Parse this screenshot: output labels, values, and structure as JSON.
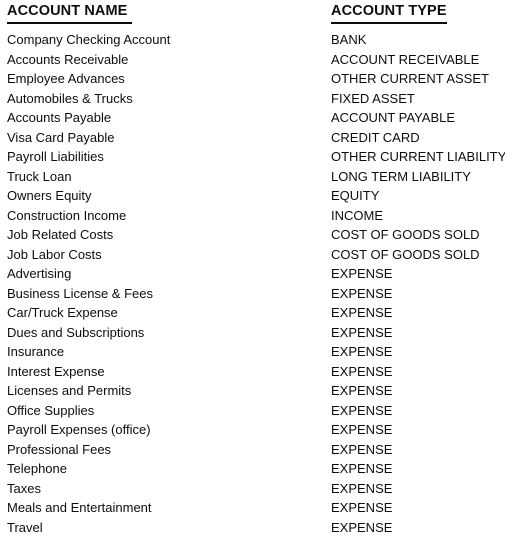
{
  "table": {
    "columns": [
      {
        "key": "name",
        "label": "ACCOUNT NAME "
      },
      {
        "key": "type",
        "label": "ACCOUNT TYPE"
      }
    ],
    "rows": [
      {
        "name": "Company Checking Account",
        "type": "BANK"
      },
      {
        "name": "Accounts Receivable",
        "type": "ACCOUNT RECEIVABLE"
      },
      {
        "name": "Employee Advances",
        "type": "OTHER CURRENT ASSET"
      },
      {
        "name": "Automobiles & Trucks",
        "type": "FIXED ASSET"
      },
      {
        "name": "Accounts Payable",
        "type": "ACCOUNT PAYABLE"
      },
      {
        "name": "Visa Card Payable",
        "type": "CREDIT CARD"
      },
      {
        "name": "Payroll Liabilities",
        "type": "OTHER CURRENT LIABILITY"
      },
      {
        "name": "Truck Loan",
        "type": "LONG TERM LIABILITY"
      },
      {
        "name": "Owners Equity",
        "type": "EQUITY"
      },
      {
        "name": "Construction Income",
        "type": "INCOME"
      },
      {
        "name": "Job Related Costs",
        "type": "COST OF GOODS SOLD"
      },
      {
        "name": "Job Labor Costs",
        "type": "COST OF GOODS SOLD"
      },
      {
        "name": "Advertising",
        "type": "EXPENSE"
      },
      {
        "name": "Business License & Fees",
        "type": "EXPENSE"
      },
      {
        "name": "Car/Truck Expense",
        "type": "EXPENSE"
      },
      {
        "name": "Dues and Subscriptions",
        "type": "EXPENSE"
      },
      {
        "name": "Insurance",
        "type": "EXPENSE"
      },
      {
        "name": "Interest Expense",
        "type": "EXPENSE"
      },
      {
        "name": "Licenses and Permits",
        "type": "EXPENSE"
      },
      {
        "name": "Office Supplies",
        "type": "EXPENSE"
      },
      {
        "name": "Payroll Expenses (office)",
        "type": "EXPENSE"
      },
      {
        "name": "Professional Fees",
        "type": "EXPENSE"
      },
      {
        "name": "Telephone",
        "type": "EXPENSE"
      },
      {
        "name": "Taxes",
        "type": "EXPENSE"
      },
      {
        "name": "Meals and Entertainment",
        "type": "EXPENSE"
      },
      {
        "name": "Travel",
        "type": "EXPENSE"
      }
    ]
  },
  "colors": {
    "text": "#0d0d12",
    "background": "#ffffff",
    "rule": "#0d0d12"
  }
}
